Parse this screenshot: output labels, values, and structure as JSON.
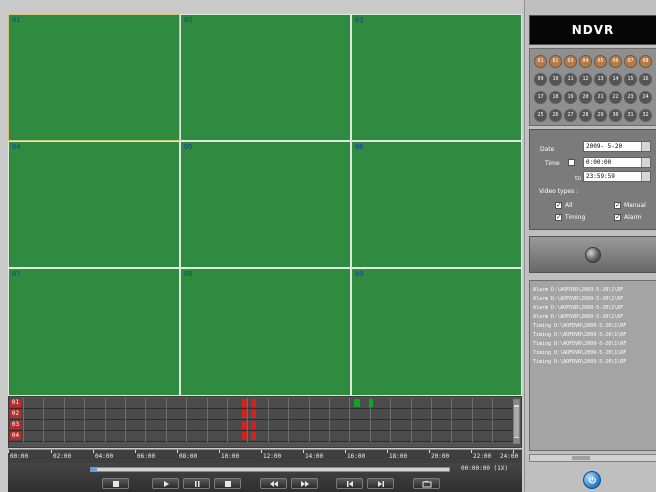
{
  "brand": {
    "title": "NDVR"
  },
  "video_grid": {
    "cells": [
      "01",
      "02",
      "03",
      "04",
      "05",
      "06",
      "07",
      "08",
      "09"
    ]
  },
  "timeline": {
    "channels": [
      "01",
      "02",
      "03",
      "04"
    ],
    "time_labels": [
      "00:00",
      "02:00",
      "04:00",
      "06:00",
      "08:00",
      "10:00",
      "12:00",
      "14:00",
      "16:00",
      "18:00",
      "20:00",
      "22:00",
      "24:00"
    ]
  },
  "playback": {
    "time": "00:00:00 (1X)",
    "buttons": [
      "stop",
      "play",
      "pause",
      "step",
      "rewind",
      "forward",
      "previous",
      "next",
      "snapshot"
    ]
  },
  "channel_buttons": {
    "labels": [
      "01",
      "02",
      "03",
      "04",
      "05",
      "06",
      "07",
      "08",
      "09",
      "10",
      "11",
      "12",
      "13",
      "14",
      "15",
      "16",
      "17",
      "18",
      "19",
      "20",
      "21",
      "22",
      "23",
      "24",
      "25",
      "26",
      "27",
      "28",
      "29",
      "30",
      "31",
      "32"
    ]
  },
  "search": {
    "date_label": "Date",
    "date_value": "2009- 5-20",
    "time_label": "Time",
    "time_from": "0:00:00",
    "to_label": "to",
    "time_to": "23:59:59",
    "video_types_label": "Video types :",
    "types": {
      "all": "All",
      "manual": "Manual",
      "timing": "Timing",
      "alarm": "Alarm"
    }
  },
  "records": [
    "Alarm  D:\\AOFDVR\\2009-5-20\\1\\RF",
    "Alarm  D:\\AOFDVR\\2009-5-20\\1\\RF",
    "Alarm  D:\\AOFDVR\\2009-5-20\\1\\RF",
    "Alarm  D:\\AOFDVR\\2009-5-20\\1\\RF",
    "Timing D:\\AOFDVR\\2009-5-20\\1\\RF",
    "Timing D:\\AOFDVR\\2009-5-20\\1\\RF",
    "Timing D:\\AOFDVR\\2009-5-20\\1\\RF",
    "Timing D:\\AOFDVR\\2009-5-20\\1\\RF",
    "Timing D:\\AOFDVR\\2009-5-20\\1\\RF"
  ],
  "colors": {
    "video": "#2f8b3f",
    "alarm": "#d62121",
    "timing": "#12a12b",
    "accent": "#1b74d1"
  }
}
